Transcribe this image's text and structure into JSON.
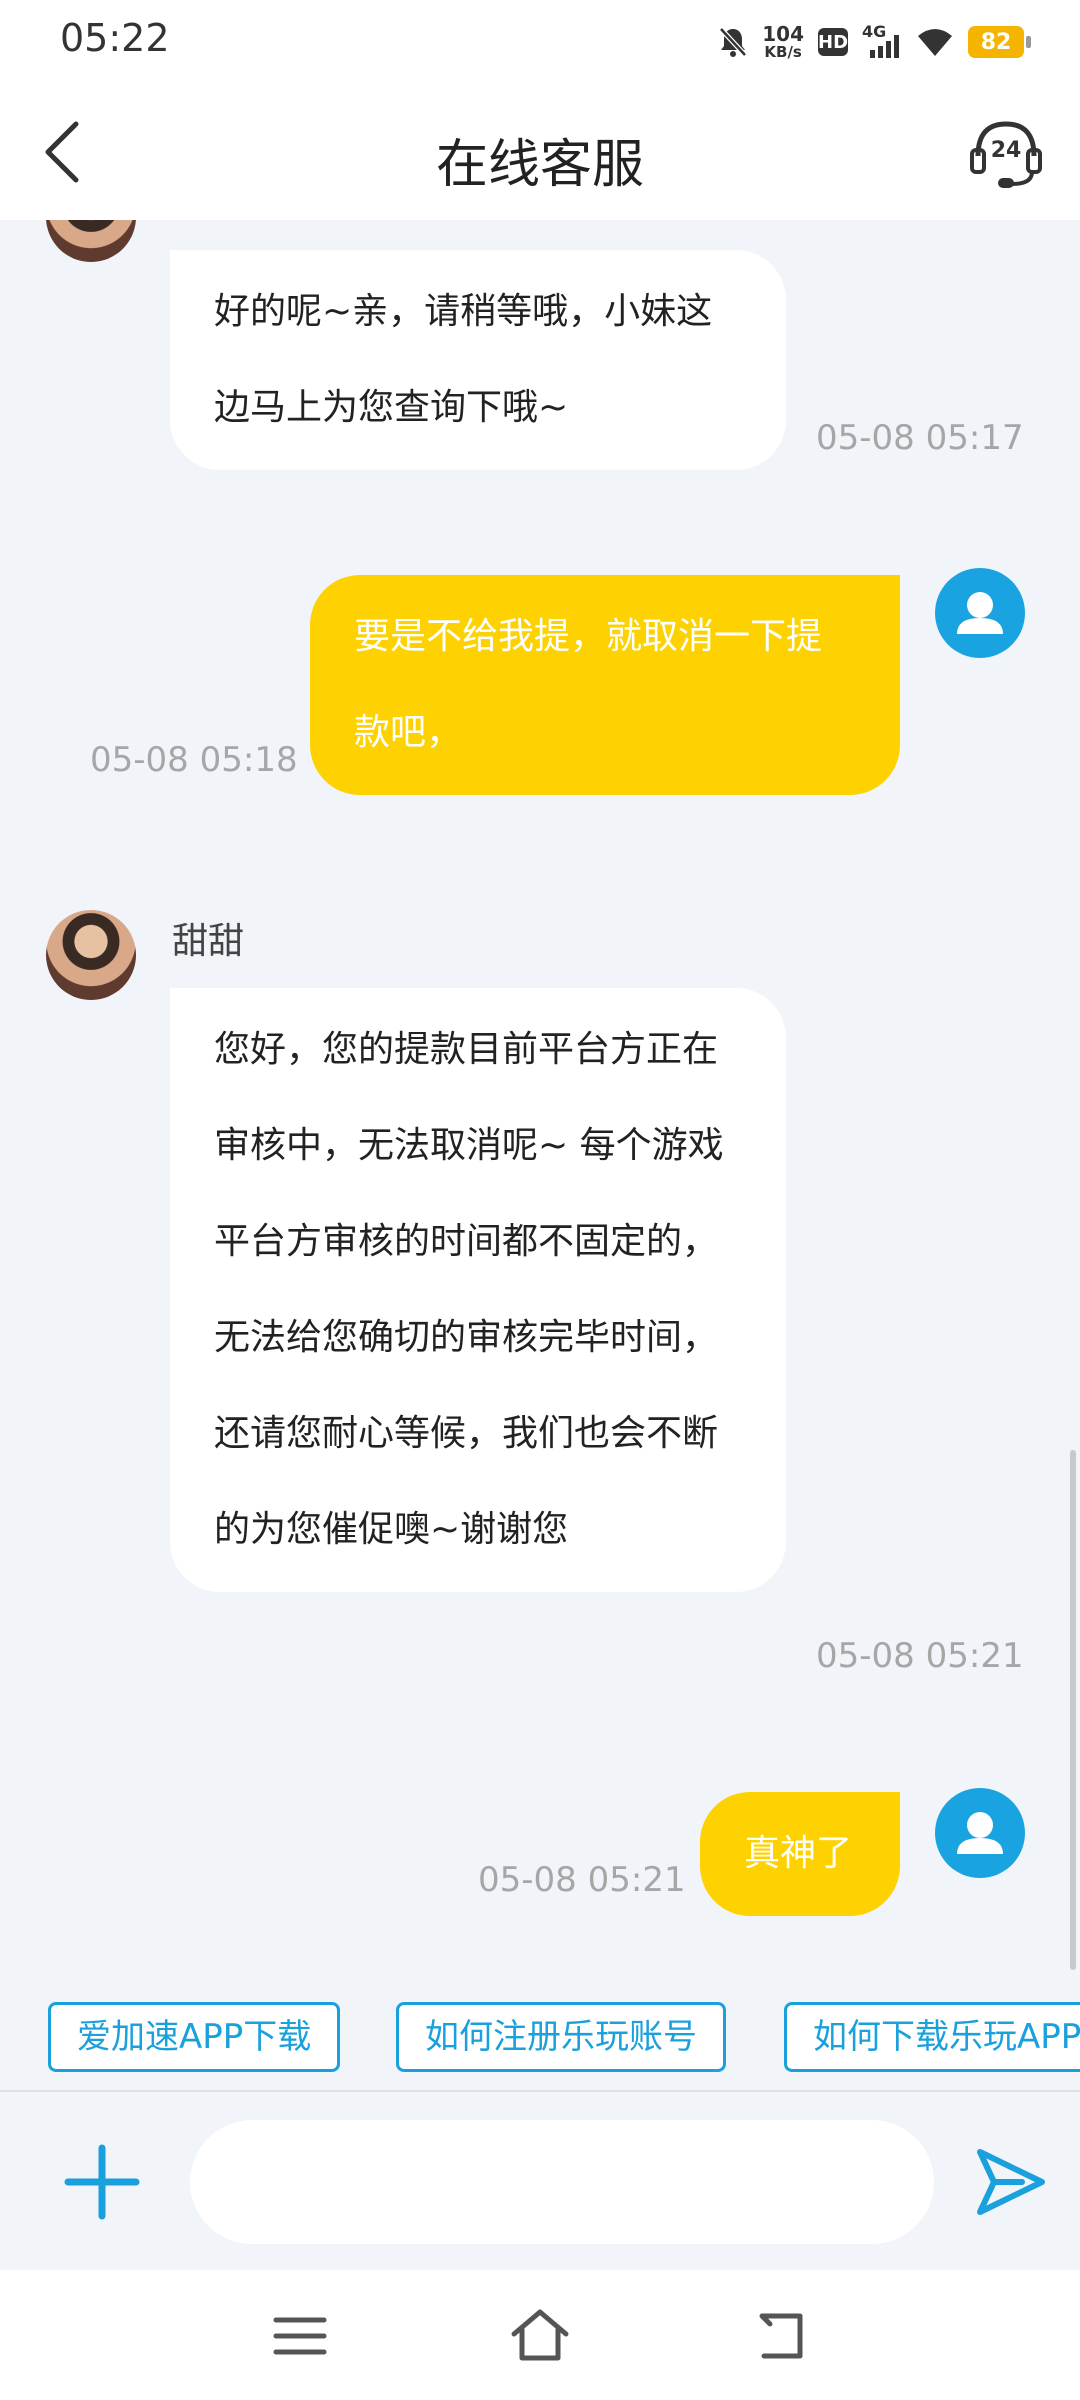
{
  "status_bar": {
    "time": "05:22",
    "speed_value": "104",
    "speed_unit": "KB/s",
    "hd": "HD",
    "network": "4G",
    "battery": "82"
  },
  "header": {
    "title": "在线客服",
    "support_badge": "24"
  },
  "messages": [
    {
      "from": "agent",
      "text": "好的呢~亲，请稍等哦，小妹这边马上为您查询下哦~",
      "time": "05-08 05:17"
    },
    {
      "from": "user",
      "text": "要是不给我提，就取消一下提款吧，",
      "time": "05-08 05:18"
    },
    {
      "from": "agent",
      "name": "甜甜",
      "text": "您好，您的提款目前平台方正在审核中，无法取消呢~ 每个游戏平台方审核的时间都不固定的，无法给您确切的审核完毕时间，还请您耐心等候，我们也会不断的为您催促噢~谢谢您",
      "time": "05-08 05:21"
    },
    {
      "from": "user",
      "text": "真神了",
      "time": "05-08 05:21"
    }
  ],
  "quick_replies": [
    "爱加速APP下载",
    "如何注册乐玩账号",
    "如何下载乐玩APP"
  ],
  "input": {
    "placeholder": ""
  },
  "colors": {
    "accent": "#1aa0dc",
    "user_bubble": "#fdd200",
    "background": "#f1f4f8"
  }
}
